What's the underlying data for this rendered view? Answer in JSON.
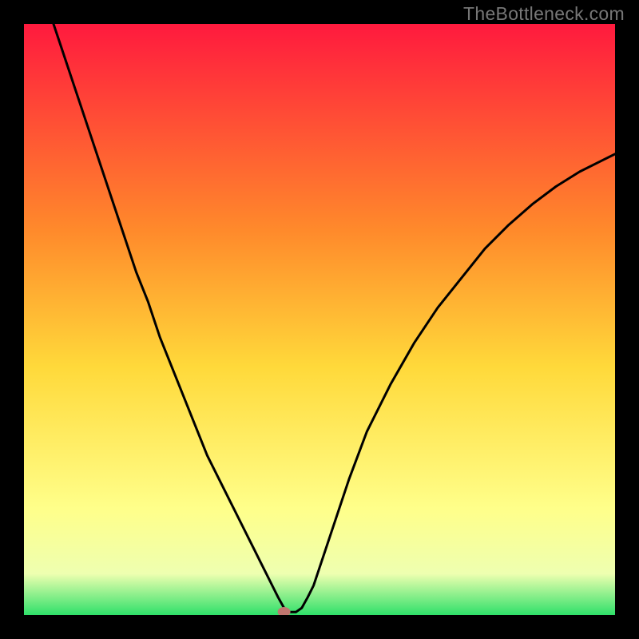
{
  "watermark": "TheBottleneck.com",
  "chart_data": {
    "type": "line",
    "title": "",
    "subtitle": "",
    "xlabel": "",
    "ylabel": "",
    "xlim": [
      0,
      100
    ],
    "ylim": [
      0,
      100
    ],
    "grid": false,
    "legend": false,
    "annotations": [],
    "marker": {
      "x": 44,
      "y": 0,
      "color": "#c0766f"
    },
    "background_gradient": {
      "top": "#ff1a3e",
      "mid_upper": "#ff8a2b",
      "mid": "#ffd93a",
      "mid_lower": "#ffff8a",
      "lower": "#eeffb0",
      "bottom": "#2fe06a"
    },
    "series": [
      {
        "name": "curve",
        "color": "#000000",
        "x": [
          5,
          7,
          9,
          11,
          13,
          15,
          17,
          19,
          21,
          23,
          25,
          27,
          29,
          31,
          33,
          35,
          37,
          38,
          39,
          40,
          41,
          42,
          43,
          44,
          45,
          46,
          47,
          48,
          49,
          50,
          51,
          53,
          55,
          58,
          62,
          66,
          70,
          74,
          78,
          82,
          86,
          90,
          94,
          98,
          100
        ],
        "y": [
          100,
          94,
          88,
          82,
          76,
          70,
          64,
          58,
          53,
          47,
          42,
          37,
          32,
          27,
          23,
          19,
          15,
          13,
          11,
          9,
          7,
          5,
          3,
          1.2,
          0.5,
          0.5,
          1.2,
          3,
          5,
          8,
          11,
          17,
          23,
          31,
          39,
          46,
          52,
          57,
          62,
          66,
          69.5,
          72.5,
          75,
          77,
          78
        ]
      }
    ]
  }
}
